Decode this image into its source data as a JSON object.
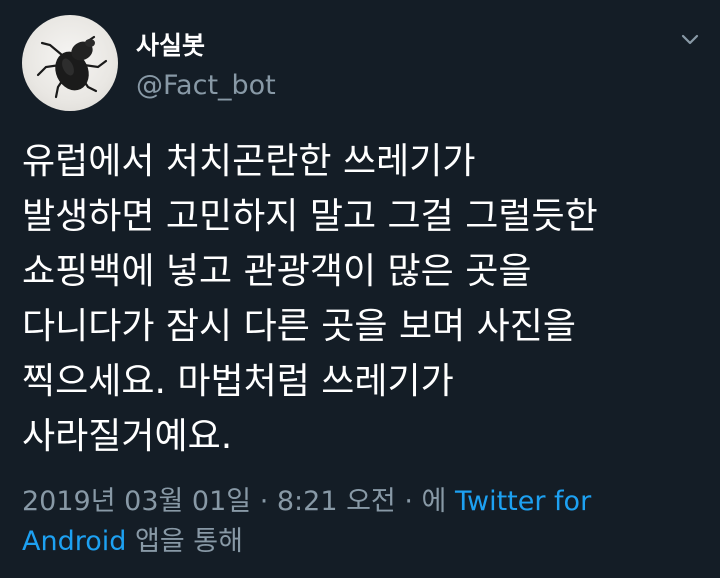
{
  "tweet": {
    "author": {
      "display_name": "사실봇",
      "handle": "@Fact_bot",
      "avatar_icon": "beetle-avatar"
    },
    "menu_icon": "chevron-down-icon",
    "text_lines": [
      "유럽에서 처치곤란한 쓰레기가",
      "발생하면 고민하지 말고 그걸 그럴듯한",
      "쇼핑백에 넣고 관광객이 많은 곳을",
      "다니다가 잠시 다른 곳을 보며 사진을",
      "찍으세요. 마법처럼 쓰레기가",
      "사라질거예요."
    ],
    "meta": {
      "date": "2019년 03월 01일",
      "separator1": " · ",
      "time": "8:21 오전",
      "separator2": " · ",
      "via_prefix": "에 ",
      "source_line1": "Twitter for",
      "source_line2": "Android",
      "via_suffix": " 앱을 통해"
    },
    "colors": {
      "background": "#141d26",
      "text": "#ffffff",
      "secondary": "#8899a6",
      "link": "#1da1f2"
    }
  }
}
